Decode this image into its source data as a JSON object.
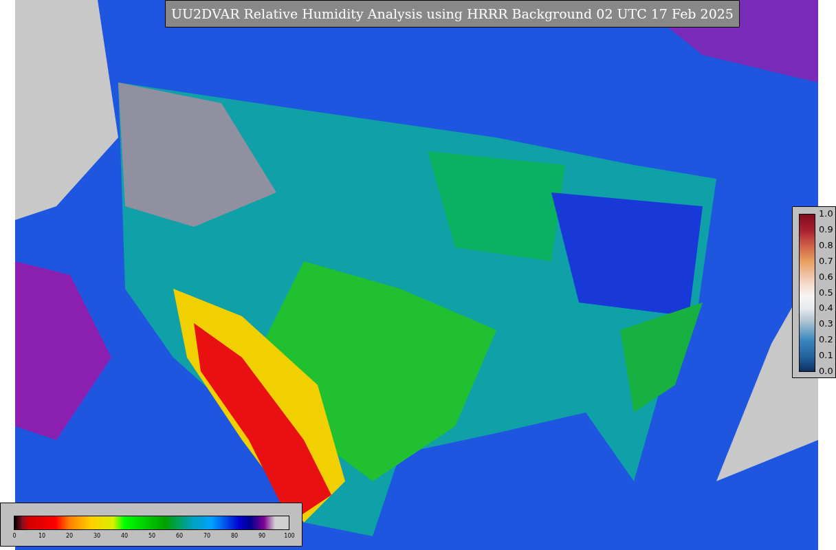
{
  "title": "UU2DVAR Relative Humidity Analysis using HRRR Background 02 UTC 17 Feb 2025",
  "humidity_colorbar": {
    "ticks": [
      "0",
      "10",
      "20",
      "30",
      "40",
      "50",
      "60",
      "70",
      "80",
      "90",
      "100"
    ]
  },
  "innovation_colorbar": {
    "ticks": [
      "1.0",
      "0.9",
      "0.8",
      "0.7",
      "0.6",
      "0.5",
      "0.4",
      "0.3",
      "0.2",
      "0.1",
      "0.0"
    ]
  }
}
